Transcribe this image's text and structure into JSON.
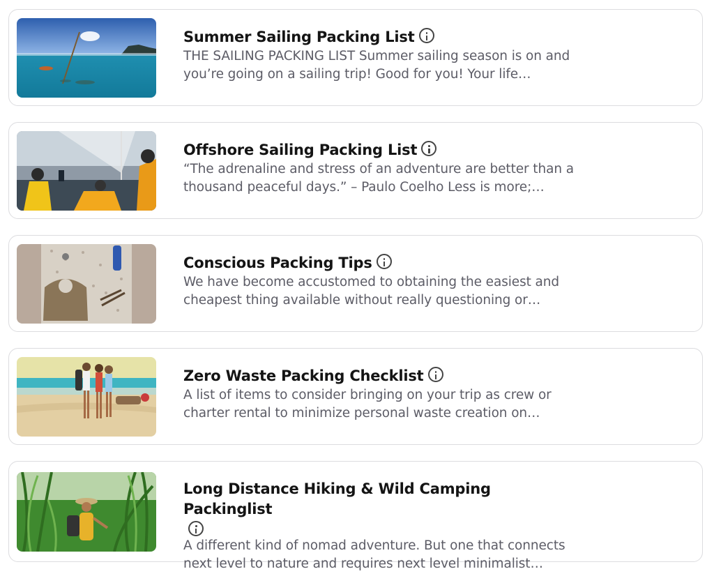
{
  "cards": [
    {
      "title": "Summer Sailing Packing List",
      "description": "THE SAILING PACKING LIST Summer sailing season is on and you’re going on a sailing trip! Good for you! Your life…",
      "image_alt": "Sailboats in turquoise harbor"
    },
    {
      "title": "Offshore Sailing Packing List",
      "description": "“The adrenaline and stress of an adventure are better than a thousand peaceful days.” – Paulo Coelho Less is more;…",
      "image_alt": "Crew in yellow foul weather gear on deck"
    },
    {
      "title": "Conscious Packing Tips",
      "description": "We have become accustomed to obtaining the easiest and cheapest thing available without really questioning or…",
      "image_alt": "Canvas bag and bottle on pebble beach"
    },
    {
      "title": "Zero Waste Packing Checklist",
      "description": "A list of items to consider bringing on your trip as crew or charter rental to minimize personal waste creation on…",
      "image_alt": "Group of travelers on a sandy beach"
    },
    {
      "title": "Long Distance Hiking & Wild Camping Packinglist",
      "description": "A different kind of nomad adventure. But one that connects next level to nature and requires next level minimalist…",
      "image_alt": "Hiker in tall green grass"
    }
  ]
}
